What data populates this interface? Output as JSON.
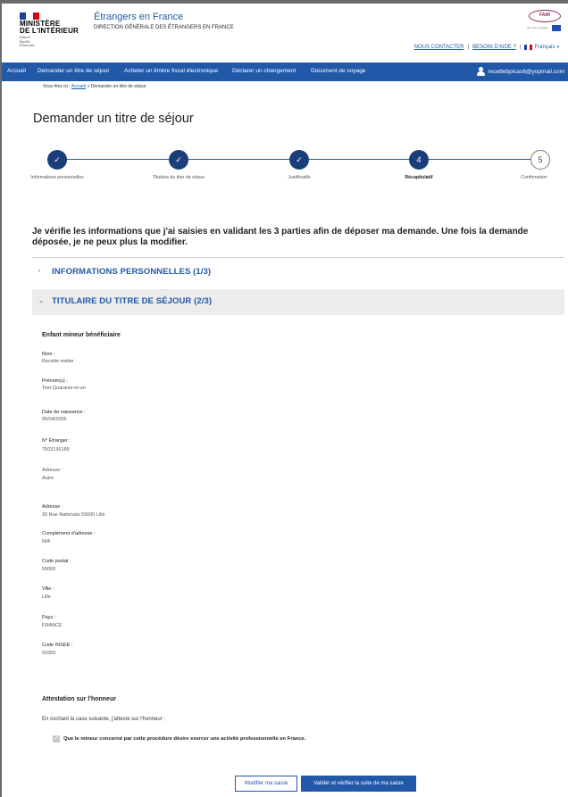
{
  "colors": {
    "primary": "#2158a8",
    "stepper_done": "#1b3e7a",
    "flag_blue": "#1d3f9c",
    "flag_white": "#ffffff",
    "flag_red": "#e1000f",
    "accordion_active_bg": "#ececec"
  },
  "header": {
    "ministry_line1": "MINISTÈRE",
    "ministry_line2": "DE L'INTÉRIEUR",
    "motto_line1": "Liberté",
    "motto_line2": "Égalité",
    "motto_line3": "Fraternité",
    "site_title": "Étrangers en France",
    "site_subtitle": "DIRECTION GÉNÉRALE DES ÉTRANGERS EN FRANCE",
    "partner_logo_text": "FAMI",
    "partner_tagline": "l'Europe s'engage",
    "links": {
      "contact": "NOUS CONTACTER",
      "help": "BESOIN D'AIDE ?",
      "separator": "|",
      "language": "Français"
    },
    "language_chevron": "chevron-down-icon"
  },
  "nav": {
    "items": [
      "Accueil",
      "Demander un titre de séjour",
      "Acheter un timbre fiscal électronique",
      "Déclarer un changement",
      "Document de voyage"
    ],
    "user_email": "recettebpicas6@yopmail.com",
    "user_icon": "user-icon"
  },
  "breadcrumb": {
    "prefix": "Vous êtes ici :",
    "home": "Accueil",
    "separator": ">",
    "current": "Demander un titre de séjour"
  },
  "page_title": "Demander un titre de séjour",
  "stepper": {
    "done_icon": "check-icon",
    "steps": [
      {
        "number": "1",
        "label": "Informations personnelles",
        "status": "done"
      },
      {
        "number": "2",
        "label": "Titulaire du titre de séjour",
        "status": "done"
      },
      {
        "number": "3",
        "label": "Justificatifs",
        "status": "done"
      },
      {
        "number": "4",
        "label": "Récapitulatif",
        "status": "current"
      },
      {
        "number": "5",
        "label": "Confirmation",
        "status": "pending"
      }
    ]
  },
  "intro": "Je vérifie les informations que j'ai saisies en validant les 3 parties afin de déposer ma demande. Une fois la demande déposée, je ne peux plus la modifier.",
  "accordions": [
    {
      "title": "INFORMATIONS PERSONNELLES (1/3)",
      "expanded": false
    },
    {
      "title": "TITULAIRE DU TITRE DE SÉJOUR (2/3)",
      "expanded": true
    }
  ],
  "panel": {
    "title": "Enfant mineur bénéficiaire",
    "fields": [
      {
        "label": "Nom :",
        "value": "Recette métier"
      },
      {
        "label": "Prénom(s) :",
        "value": "Test Quarante-et-un"
      },
      {
        "label": "Date de naissance :",
        "value": "05/04/2006"
      },
      {
        "label": "N° Étranger :",
        "value": "7503136189"
      },
      {
        "label": "Adresse :",
        "value": "Autre"
      },
      {
        "label": "Adresse :",
        "value": "20 Rue Nationale 59000 Lille"
      },
      {
        "label": "Complément d'adresse :",
        "value": "N/A"
      },
      {
        "label": "Code postal :",
        "value": "59000"
      },
      {
        "label": "Ville :",
        "value": "Lille"
      },
      {
        "label": "Pays :",
        "value": "FRANCE"
      },
      {
        "label": "Code INSEE :",
        "value": "59350"
      }
    ]
  },
  "attestation": {
    "title": "Attestation sur l'honneur",
    "text": "En cochant la case suivante, j'atteste sur l'honneur :",
    "checkbox_label": "Que le mineur concerné par cette procédure désire exercer une activité professionnelle en France.",
    "checked": true
  },
  "buttons": {
    "modify": "Modifier ma saisie",
    "validate": "Valider et vérifier la suite de ma saisie"
  }
}
